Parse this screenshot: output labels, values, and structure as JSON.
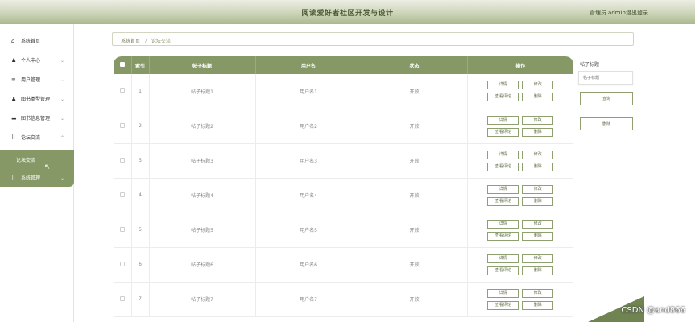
{
  "header": {
    "title": "阅读爱好者社区开发与设计",
    "user": "管理员 admin",
    "logout": "退出登录"
  },
  "sidebar": {
    "items": [
      {
        "label": "系统首页",
        "icon": "home-icon",
        "glyph": "⌂",
        "chevron": ""
      },
      {
        "label": "个人中心",
        "icon": "user-icon",
        "glyph": "♟",
        "chevron": "⌄"
      },
      {
        "label": "用户管理",
        "icon": "list-icon",
        "glyph": "≡",
        "chevron": "⌄"
      },
      {
        "label": "图书类型管理",
        "icon": "user-icon",
        "glyph": "♟",
        "chevron": "⌄"
      },
      {
        "label": "图书信息管理",
        "icon": "book-icon",
        "glyph": "▬",
        "chevron": "⌄"
      },
      {
        "label": "论坛交流",
        "icon": "grid-icon",
        "glyph": "⠿",
        "chevron": "⌃"
      }
    ],
    "sub_active": "论坛交流",
    "system": {
      "label": "系统管理",
      "icon": "grid-icon",
      "glyph": "⠿",
      "chevron": "⌄"
    }
  },
  "breadcrumb": {
    "home": "系统首页",
    "separator": "/",
    "current": "论坛交流"
  },
  "table": {
    "columns": [
      "",
      "索引",
      "帖子标题",
      "用户名",
      "状态",
      "操作"
    ],
    "actions": {
      "detail": "详情",
      "edit": "修改",
      "review": "查看评论",
      "delete": "删除"
    },
    "rows": [
      {
        "index": "1",
        "title": "帖子标题1",
        "username": "用户名1",
        "status": "开放"
      },
      {
        "index": "2",
        "title": "帖子标题2",
        "username": "用户名2",
        "status": "开放"
      },
      {
        "index": "3",
        "title": "帖子标题3",
        "username": "用户名3",
        "status": "开放"
      },
      {
        "index": "4",
        "title": "帖子标题4",
        "username": "用户名4",
        "status": "开放"
      },
      {
        "index": "5",
        "title": "帖子标题5",
        "username": "用户名5",
        "status": "开放"
      },
      {
        "index": "6",
        "title": "帖子标题6",
        "username": "用户名6",
        "status": "开放"
      },
      {
        "index": "7",
        "title": "帖子标题7",
        "username": "用户名7",
        "status": "开放"
      }
    ]
  },
  "search": {
    "label": "帖子标题",
    "placeholder": "帖子标题",
    "button": "查询",
    "delete_button": "删除"
  },
  "watermark": "CSDN @and866",
  "colors": {
    "accent": "#859866",
    "header_dark": "#4a5a32"
  }
}
